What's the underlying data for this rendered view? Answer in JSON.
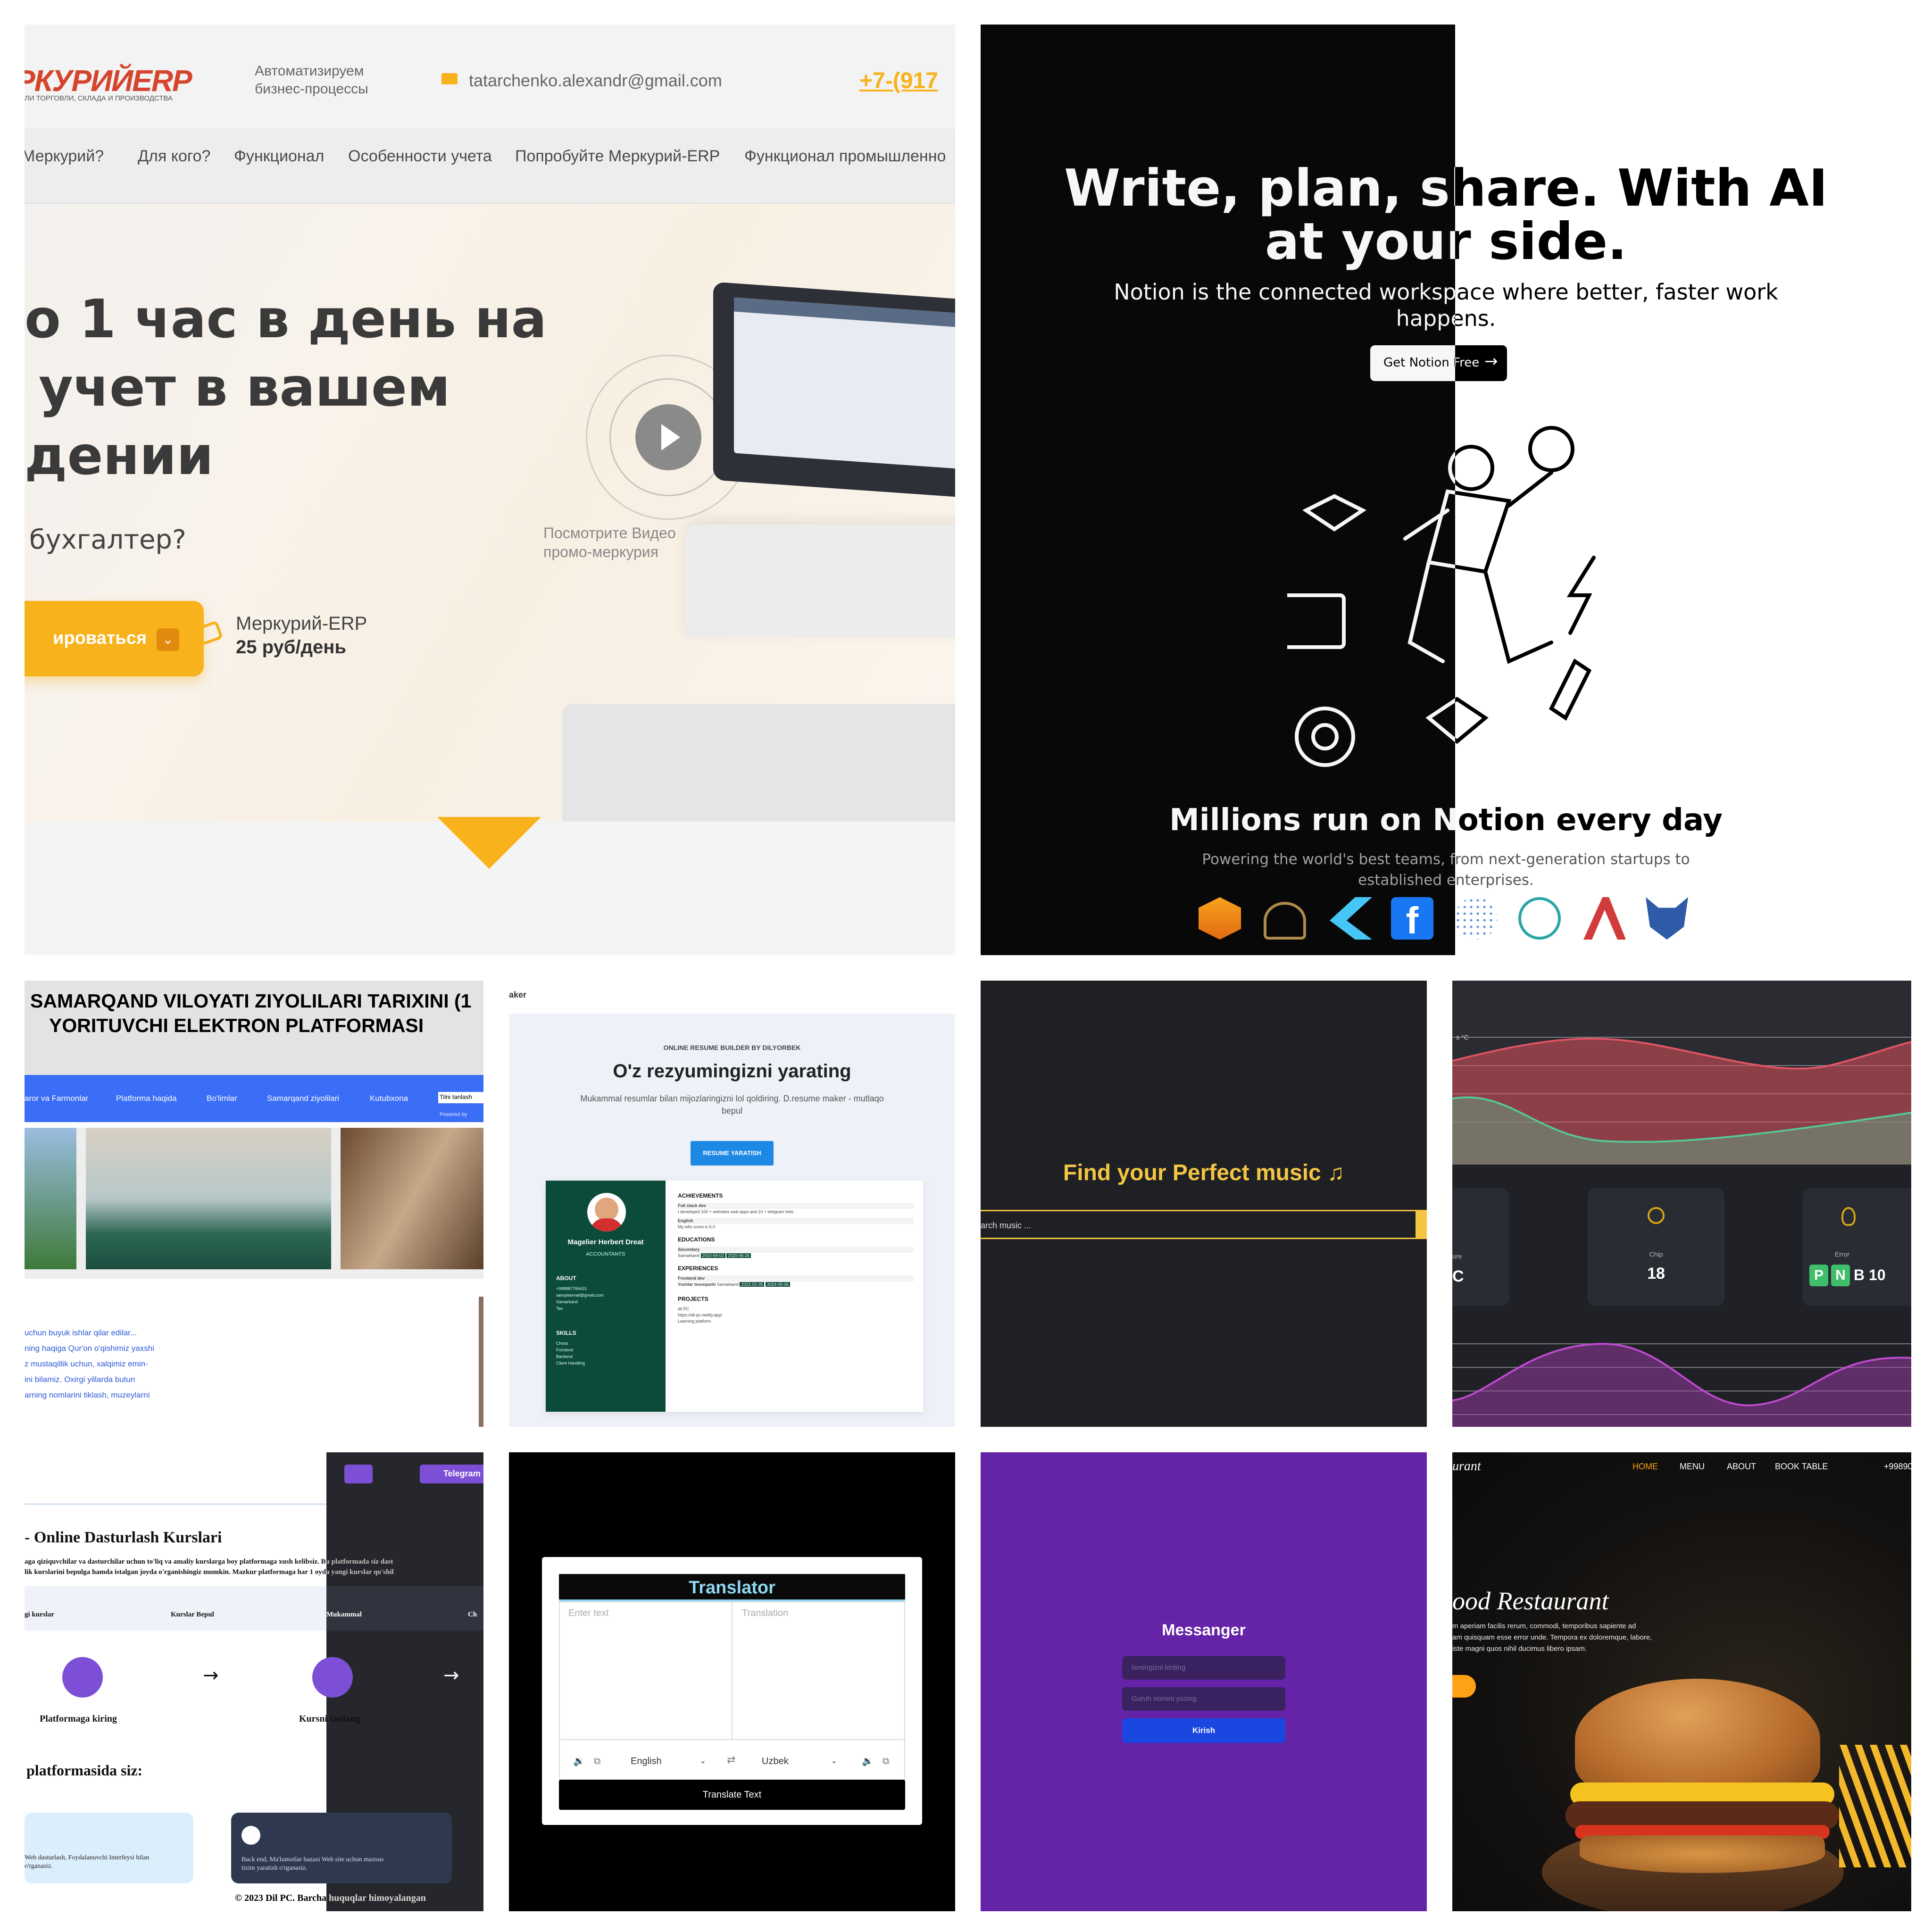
{
  "erp": {
    "logo": "РКУРИЙERP",
    "logo_sub": "ЛИ ТОРГОВЛИ, СКЛАДА И ПРОИЗВОДСТВА",
    "tagline_1": "Автоматизируем",
    "tagline_2": "бизнес-процессы",
    "email": "tatarchenko.alexandr@gmail.com",
    "phone": "+7-(917",
    "nav": [
      "Меркурий?",
      "Для кого?",
      "Функционал",
      "Особенности учета",
      "Попробуйте Меркурий-ERP",
      "Функционал промышленно"
    ],
    "headline_1": "о 1 час в день на",
    "headline_2": "учет в вашем",
    "headline_3": "дении",
    "subhead": "бухгалтер?",
    "cta": "ироваться",
    "price_1": "Меркурий-ERP",
    "price_2": "25 руб/день",
    "video_1": "Посмотрите Видео",
    "video_2": "промо-меркурия"
  },
  "notion": {
    "headline_1": "Write, plan, share. With AI",
    "headline_2": "at your side.",
    "sub_1": "Notion is the connected workspace where better, faster work",
    "sub_2": "happens.",
    "cta": "Get Notion Free",
    "millions": "Millions run on Notion every day",
    "powering_1": "Powering the world's best teams, from next-generation startups to",
    "powering_2": "established enterprises."
  },
  "samarqand": {
    "title_1": "SAMARQAND VILOYATI ZIYOLILARI TARIXINI (1",
    "title_2": "YORITUVCHI ELEKTRON PLATFORMASI",
    "nav": [
      "aror va Farmonlar",
      "Platforma haqida",
      "Bo'limlar",
      "Samarqand ziyolilari",
      "Kutubxona"
    ],
    "lang": "Tilni tanlash",
    "powered": "Powered by",
    "text": [
      "uchun buyuk ishlar qilar edilar...",
      "ning haqiga Qur'on o'qishimiz yaxshi",
      "z mustaqillik uchun, xalqimiz emin-",
      "ini bilamiz. Oxirgi yillarda butun",
      "arning nomlarini tiklash, muzeylarni"
    ]
  },
  "resume": {
    "brand": "aker",
    "kicker": "ONLINE RESUME BUILDER BY DILYORBEK",
    "title": "O'z rezyumingizni yarating",
    "desc_1": "Mukammal resumlar bilan mijozlaringizni lol qoldiring. D.resume maker - mutlaqo",
    "desc_2": "bepul",
    "cta": "RESUME YARATISH",
    "name": "Magelier Herbert Dreat",
    "role": "ACCOUNTANTS",
    "about": "ABOUT",
    "about_lines": [
      "+998887766431",
      "sampleemail@gmail.com",
      "Samarkand",
      "Tax"
    ],
    "skills": "SKILLS",
    "skill_lines": [
      "Chess",
      "Frontend",
      "Backend",
      "Client Handling"
    ],
    "achievements": "ACHIEVEMENTS",
    "ach_1": "Full stack dev",
    "ach_1b": "I developed 100 + websites web apps and 10 + telegram bots",
    "ach_2": "English",
    "ach_2b": "My ielts score is 6.0",
    "educations": "EDUCATIONS",
    "edu_1": "Secondary",
    "edu_1b": "Samarkand",
    "experiences": "EXPERIENCES",
    "exp_1": "Frontend dev",
    "exp_1b": "Yoshlar texnoparki",
    "exp_1c": "Samarkand",
    "projects": "PROJECTS",
    "proj_lines": [
      "dil PC",
      "https://dil-pc.netlify.app/",
      "Learning platform"
    ],
    "date_1": "2010-09-02",
    "date_2": "2020-06-26",
    "date_3": "2022-02-05",
    "date_4": "2024-05-06"
  },
  "music": {
    "title": "Find your Perfect music",
    "note": "♫",
    "placeholder": "arch music ..."
  },
  "dashboard": {
    "top_label": "s °C",
    "card1_label": "ure",
    "card1_value": "C",
    "card2_label": "Chip",
    "card2_value": "18",
    "card3_label": "Error",
    "card3_p": "P",
    "card3_n": "N",
    "card3_b": "B 10"
  },
  "dilpc": {
    "telegram": "Telegram",
    "title": "- Online Dasturlash Kurslari",
    "desc_1": "aga qiziquvchilar va dasturchilar uchun to'liq va amaliy kurslarga boy platformaga xush kelibsiz. Bu platformada siz dast",
    "desc_2": "lik kurslarini bepulga hamda istalgan joyda o'rganishingiz mumkin. Mazkur platformaga har 1 oyda yangi kurslar qo'shil",
    "features": [
      "gi kurslar",
      "Kurslar Bepul",
      "Mukammal",
      "Ch"
    ],
    "step_1": "Platformaga kiring",
    "step_2": "Kursni tanlang",
    "section": "platformasida siz:",
    "card_1a": "Web dasturlash, Foydalanuvchi Interfeysi bilan",
    "card_1b": "o'rganasiz.",
    "card_2a": "Back end, Ma'lumotlar bazasi Web site uchun maxsus",
    "card_2b": "tizim yaratish o'rganasiz.",
    "footer": "© 2023 Dil PC. Barcha huquqlar himoyalangan"
  },
  "translator": {
    "title": "Translator",
    "input_placeholder": "Enter text",
    "output_placeholder": "Translation",
    "from_lang": "English",
    "to_lang": "Uzbek",
    "button": "Translate Text"
  },
  "messenger": {
    "title": "Messanger",
    "name_placeholder": "Ismingizni kiriting",
    "group_placeholder": "Guruh nomini yozing",
    "button": "Kirish"
  },
  "restaurant": {
    "logo": "urant",
    "nav": [
      "HOME",
      "MENU",
      "ABOUT",
      "BOOK TABLE"
    ],
    "phone": "+99890",
    "title": "ood Restaurant",
    "desc_1": "m aperiam facilis rerum, commodi, temporibus sapiente ad",
    "desc_2": "am quisquam esse error unde. Tempora ex doloremque, labore,",
    "desc_3": "iste magni quos nihil ducimus libero ipsam."
  },
  "colors": {
    "erp_orange": "#f7b21c",
    "notion_black": "#080808",
    "blue_nav": "#3b6ef6",
    "resume_green": "#0c4a3a",
    "resume_blue": "#1e88e5",
    "music_yellow": "#f4c542",
    "dash_bg": "#1f2126",
    "purple": "#7b4fd0",
    "messenger_bg": "#6523a8",
    "messenger_btn": "#1a47e0",
    "restaurant_orange": "#ffa114"
  }
}
